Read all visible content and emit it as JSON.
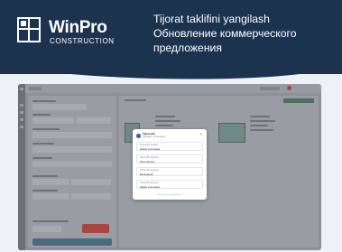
{
  "brand": {
    "name": "WinPro",
    "tagline": "CONSTRUCTION"
  },
  "headline": {
    "line1": "Tijorat taklifini yangilash",
    "line2": "Обновление коммерческого",
    "line3": "предложения"
  },
  "colors": {
    "banner": "#1c3350",
    "app_bg": "#8e9098",
    "accent_green": "#4d6f5f",
    "accent_red": "#a8453f",
    "modal_bg": "#ffffff"
  },
  "icons": {
    "logo": "window-frame-icon",
    "close": "close-icon"
  },
  "modal": {
    "title": "Тарасов5",
    "subtitle": "Продажи / Установщик",
    "close_glyph": "×",
    "items": [
      {
        "label": "Тарасов5 уведомл.",
        "value": "Новое состояние"
      },
      {
        "label": "Тарасов5 уведомл.",
        "value": "Изготовлено"
      },
      {
        "label": "Тарасов5 уведомл.",
        "value": "Выполнено"
      },
      {
        "label": "Тарасов5 уведомл.",
        "value": "Новое состояние"
      }
    ],
    "footer": "Показать все уведомления"
  }
}
